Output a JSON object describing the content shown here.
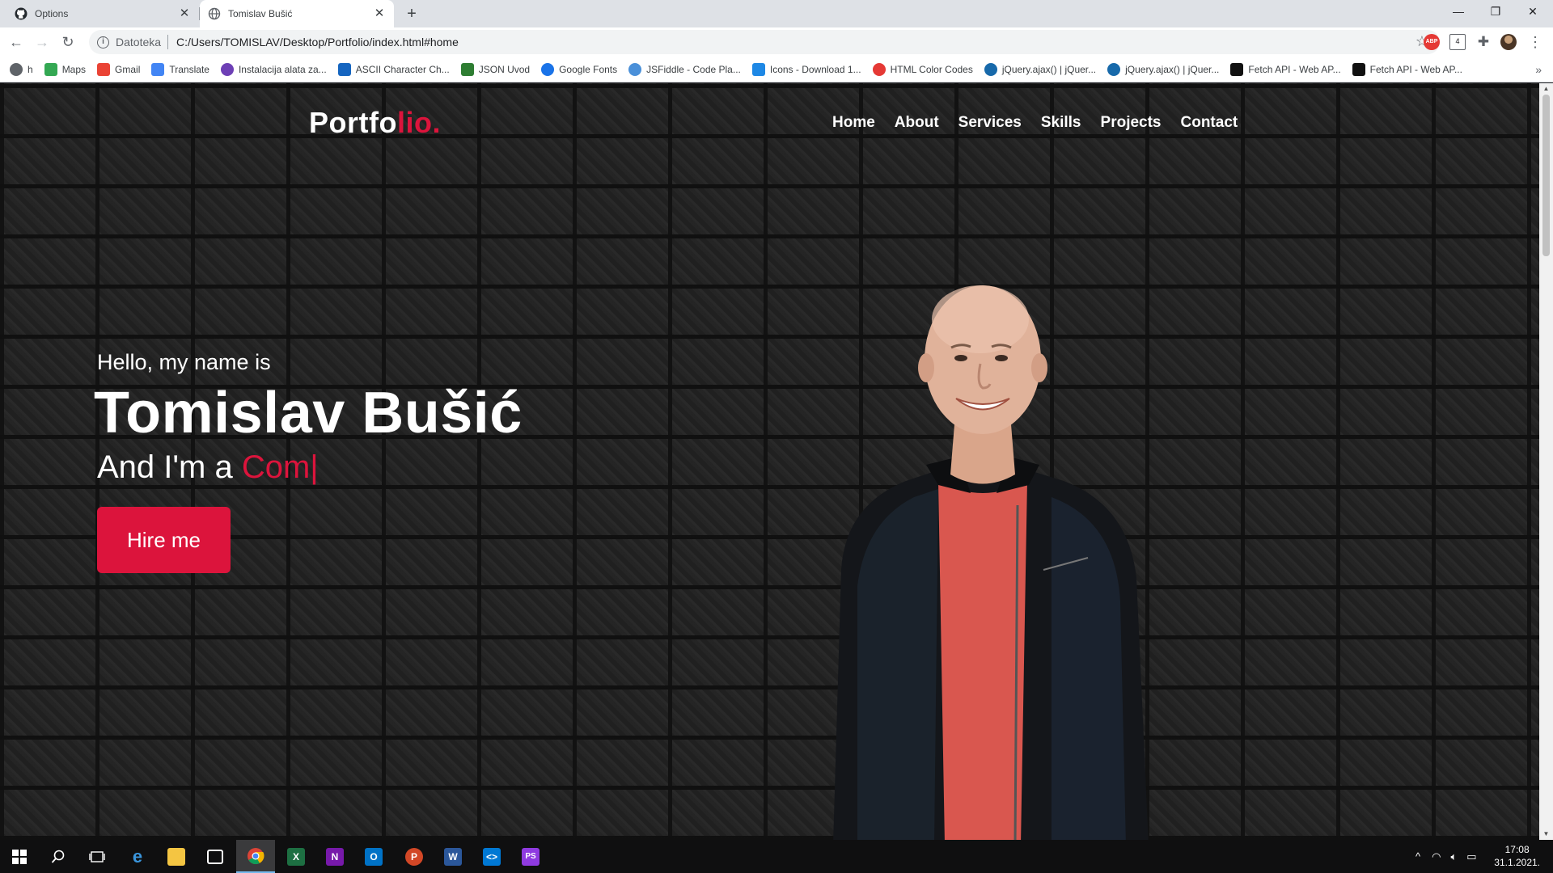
{
  "browser": {
    "tabs": [
      {
        "title": "Options",
        "icon": "github-icon"
      },
      {
        "title": "Tomislav Bušić",
        "icon": "globe-icon",
        "active": true
      }
    ],
    "url_scheme": "Datoteka",
    "url": "C:/Users/TOMISLAV/Desktop/Portfolio/index.html#home",
    "bookmarks": [
      {
        "label": "h",
        "color": "#5f6368"
      },
      {
        "label": "Maps",
        "color": "#34a853"
      },
      {
        "label": "Gmail",
        "color": "#ea4335"
      },
      {
        "label": "Translate",
        "color": "#4285f4"
      },
      {
        "label": "Instalacija alata za...",
        "color": "#6d3fb5"
      },
      {
        "label": "ASCII Character Ch...",
        "color": "#1565c0"
      },
      {
        "label": "JSON Uvod",
        "color": "#2e7d32"
      },
      {
        "label": "Google Fonts",
        "color": "#1a73e8"
      },
      {
        "label": "JSFiddle - Code Pla...",
        "color": "#4a90d9"
      },
      {
        "label": "Icons - Download 1...",
        "color": "#1e88e5"
      },
      {
        "label": "HTML Color Codes",
        "color": "#e53935"
      },
      {
        "label": "jQuery.ajax() | jQuer...",
        "color": "#1769aa"
      },
      {
        "label": "jQuery.ajax() | jQuer...",
        "color": "#1769aa"
      },
      {
        "label": "Fetch API - Web AP...",
        "color": "#111111"
      },
      {
        "label": "Fetch API - Web AP...",
        "color": "#111111"
      }
    ],
    "extensions": [
      "abp-icon",
      "calendar-icon",
      "puzzle-icon",
      "profile-avatar"
    ],
    "calendar_badge": "4"
  },
  "site": {
    "logo_main": "Portfo",
    "logo_accent": "lio.",
    "nav": [
      "Home",
      "About",
      "Services",
      "Skills",
      "Projects",
      "Contact"
    ],
    "hero": {
      "greeting": "Hello, my name is",
      "name": "Tomislav Bušić",
      "role_prefix": "And I'm a ",
      "role_typed": "Com",
      "cursor": "|",
      "button": "Hire me"
    },
    "accent_color": "#dc143c"
  },
  "taskbar": {
    "apps": [
      "windows-start-icon",
      "search-icon",
      "task-view-icon",
      "edge-icon",
      "file-explorer-icon",
      "store-icon",
      "chrome-icon",
      "excel-icon",
      "onenote-icon",
      "outlook-icon",
      "powerpoint-icon",
      "word-icon",
      "vscode-icon",
      "phpstorm-icon"
    ],
    "time": "17:08",
    "date": "31.1.2021."
  }
}
